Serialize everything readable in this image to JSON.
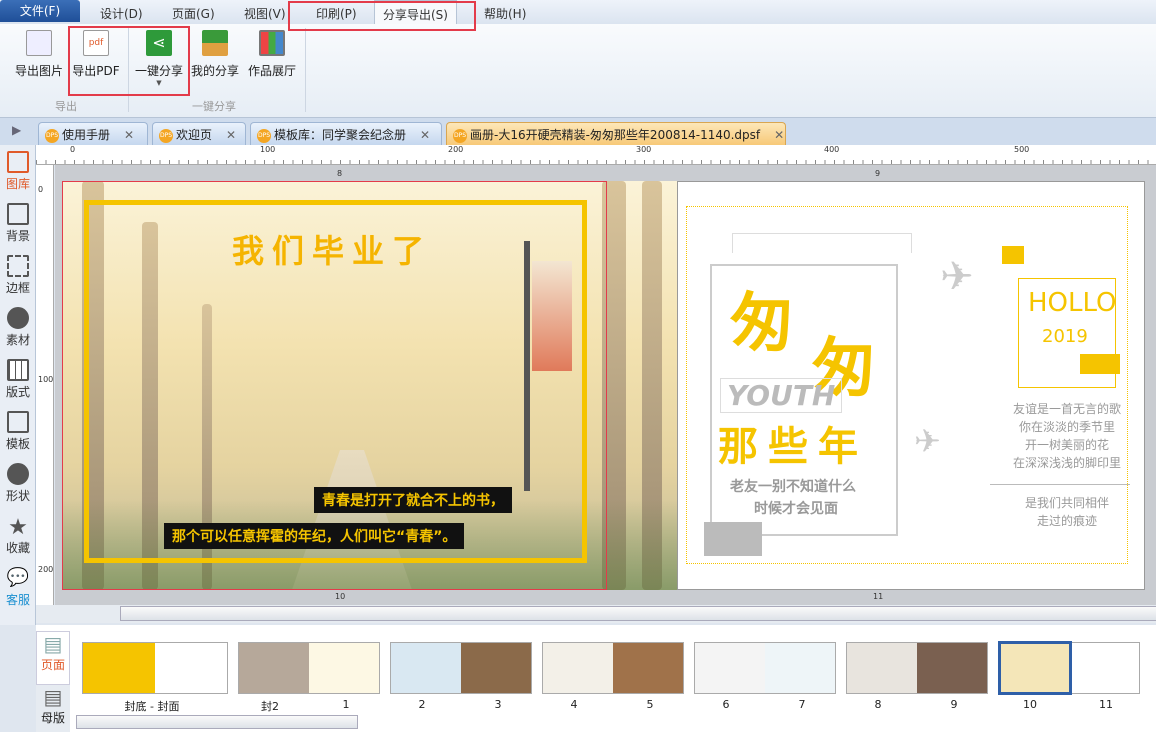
{
  "menu": {
    "file": "文件(F)",
    "items": [
      "设计(D)",
      "页面(G)",
      "视图(V)",
      "印刷(P)",
      "分享导出(S)",
      "帮助(H)"
    ]
  },
  "ribbon": {
    "buttons": [
      "导出图片",
      "导出PDF",
      "一键分享",
      "我的分享",
      "作品展厅"
    ],
    "groups": [
      "导出",
      "一键分享"
    ]
  },
  "tabs": [
    "使用手册",
    "欢迎页",
    "模板库：同学聚会纪念册",
    "画册-大16开硬壳精装-匆匆那些年200814-1140.dpsf"
  ],
  "ruler": {
    "top": [
      "0",
      "100",
      "200",
      "300",
      "400",
      "500"
    ],
    "left": [
      "0",
      "100",
      "200"
    ],
    "pages": [
      "8",
      "9",
      "10",
      "11"
    ]
  },
  "sidebar": [
    "图库",
    "背景",
    "边框",
    "素材",
    "版式",
    "模板",
    "形状",
    "收藏",
    "客服"
  ],
  "left_page": {
    "title": "我们毕业了",
    "caption1": "青春是打开了就合不上的书，",
    "caption2": "那个可以任意挥霍的年纪，人们叫它“青春”。"
  },
  "right_page": {
    "big1": "匆",
    "big2": "匆",
    "youth": "YOUTH",
    "years": "那些年",
    "sub1": "老友一别不知道什么",
    "sub2": "时候才会见面",
    "hollo": "HOLLO",
    "year": "2019",
    "poem": [
      "友谊是一首无言的歌",
      "你在淡淡的季节里",
      "开一树美丽的花",
      "在深深浅浅的脚印里"
    ],
    "poem2": [
      "是我们共同相伴",
      "走过的痕迹"
    ]
  },
  "thumbs": {
    "tabs": [
      "页面",
      "母版"
    ],
    "labels": [
      "封底 - 封面",
      "封2",
      "1",
      "2",
      "3",
      "4",
      "5",
      "6",
      "7",
      "8",
      "9",
      "10",
      "11"
    ]
  },
  "colors": {
    "accent": "#f5c400",
    "highlight": "#e33b4a"
  }
}
